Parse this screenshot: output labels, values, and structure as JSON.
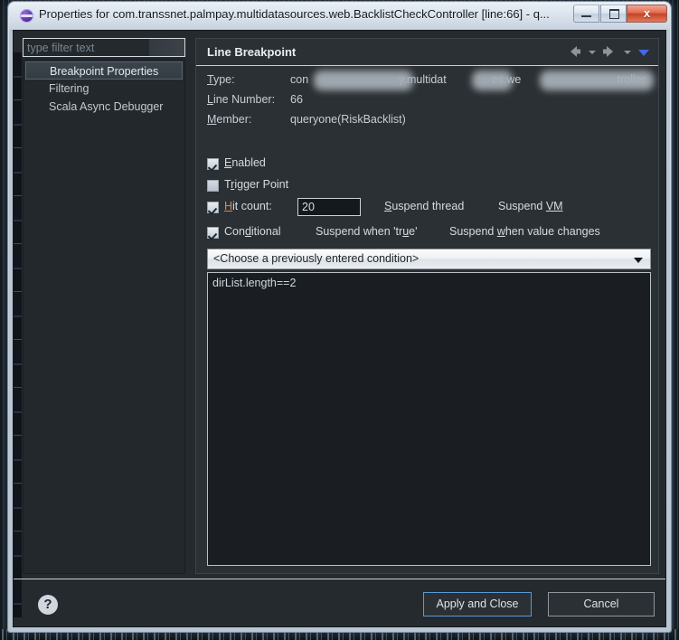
{
  "window": {
    "title": "Properties for com.transsnet.palmpay.multidatasources.web.BacklistCheckController [line:66] - q...",
    "app_icon": "eclipse-icon",
    "minimize_label": "",
    "maximize_label": "",
    "close_label": "x"
  },
  "sidebar": {
    "filter_placeholder": "type filter text",
    "filter_value": "",
    "items": [
      {
        "label": "Breakpoint Properties",
        "selected": true
      },
      {
        "label": "Filtering",
        "selected": false
      },
      {
        "label": "Scala Async Debugger",
        "selected": false
      }
    ]
  },
  "pane": {
    "title": "Line Breakpoint",
    "nav": {
      "back_icon": "arrow-left-icon",
      "back_caret_icon": "chevron-down-icon",
      "forward_icon": "arrow-right-icon",
      "forward_caret_icon": "chevron-down-icon",
      "menu_icon": "triangle-down-icon",
      "menu_color": "#4169e8"
    },
    "details": [
      {
        "label": "Type:",
        "mnemonic": "T",
        "rest": "ype:",
        "value_parts": [
          "con",
          "y.multidat",
          "es.we",
          "troller"
        ],
        "redacted": true
      },
      {
        "label": "Line Number:",
        "mnemonic": "L",
        "rest": "ine Number:",
        "value": "66",
        "redacted": false
      },
      {
        "label": "Member:",
        "mnemonic": "M",
        "rest": "ember:",
        "value": "queryone(RiskBacklist)",
        "redacted": false
      }
    ],
    "checkboxes": {
      "enabled": {
        "label_mnemonic": "E",
        "label_rest": "nabled",
        "checked": true
      },
      "trigger_point": {
        "label_pre": "T",
        "label_mnemonic": "r",
        "label_rest": "igger Point",
        "checked": false
      },
      "hit_count": {
        "label_mnemonic": "H",
        "label_rest": "it count:",
        "checked": true,
        "value": "20",
        "mnemonic_color": "#d98a52"
      },
      "conditional": {
        "label_pre": "Con",
        "label_mnemonic": "d",
        "label_rest": "itional",
        "checked": true
      }
    },
    "radios": {
      "suspend_thread": {
        "pre": "S",
        "mnemonic": "S",
        "label": "uspend thread",
        "full": "Suspend thread"
      },
      "suspend_vm": {
        "label": "Suspend VM",
        "mnemonic": "VM"
      },
      "suspend_when_true": {
        "label": "Suspend when 'true'",
        "mnemonic": "u"
      },
      "suspend_when_value_changes": {
        "label": "Suspend when value changes",
        "mnemonic": "w"
      }
    },
    "condition_combo": {
      "selected": "<Choose a previously entered condition>",
      "arrow_icon": "chevron-down-icon"
    },
    "condition_editor": {
      "text": "dirList.length==2"
    }
  },
  "footer": {
    "help_icon": "question-mark-icon",
    "help_glyph": "?",
    "apply_label": "Apply and Close",
    "cancel_label": "Cancel",
    "apply_focus_color": "#5a9ad8"
  }
}
